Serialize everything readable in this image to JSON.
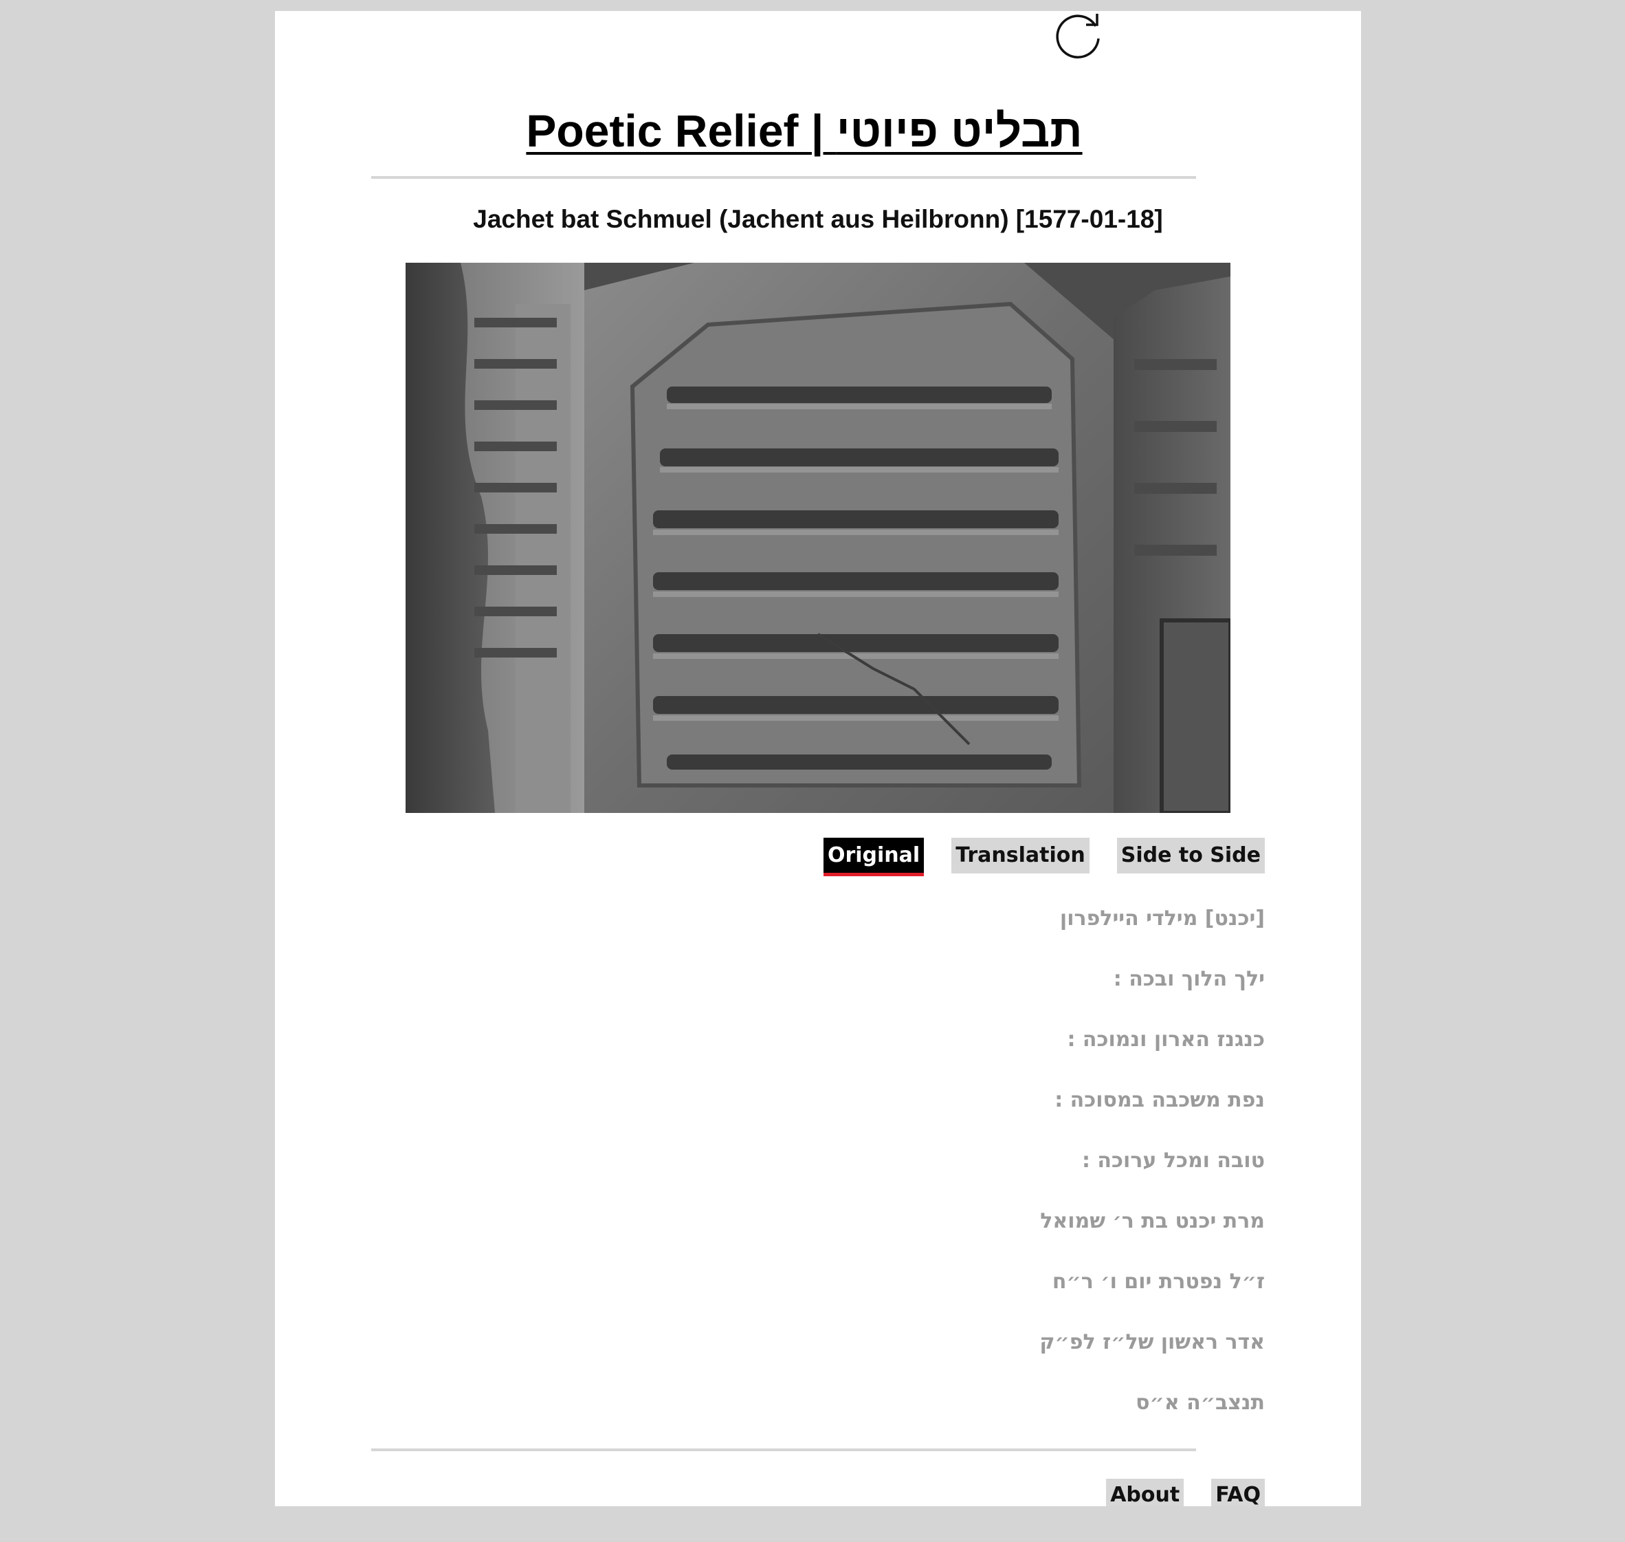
{
  "site": {
    "title": "Poetic Relief | תבליט פיוטי"
  },
  "record": {
    "title": "Jachet bat Schmuel (Jachent aus Heilbronn) [1577-01-18]"
  },
  "tabs": [
    {
      "label": "Original",
      "active": true
    },
    {
      "label": "Translation",
      "active": false
    },
    {
      "label": "Side to Side",
      "active": false
    }
  ],
  "original_lines": [
    "[יכנט] מילדי היילפרון",
    "ילך הלוך ובכה :",
    "כנגנז הארון ונמוכה :",
    "נפת משכבה במסוכה :",
    "טובה ומכל ערוכה :",
    "מרת יכנט בת ר׳ שמואל",
    "ז״ל נפטרת יום ו׳ ר״ח",
    "אדר ראשון של״ז לפ״ק",
    "תנצב״ה א״ס"
  ],
  "footer": {
    "about_label": "About",
    "faq_label": "FAQ"
  },
  "colors": {
    "page_background": "#d5d5d5",
    "content_background": "#ffffff",
    "tab_inactive": "#d7d7d7",
    "tab_active": "#000000",
    "tab_active_underline": "#e01e2a",
    "hebrew_text": "#9a9a9a"
  }
}
